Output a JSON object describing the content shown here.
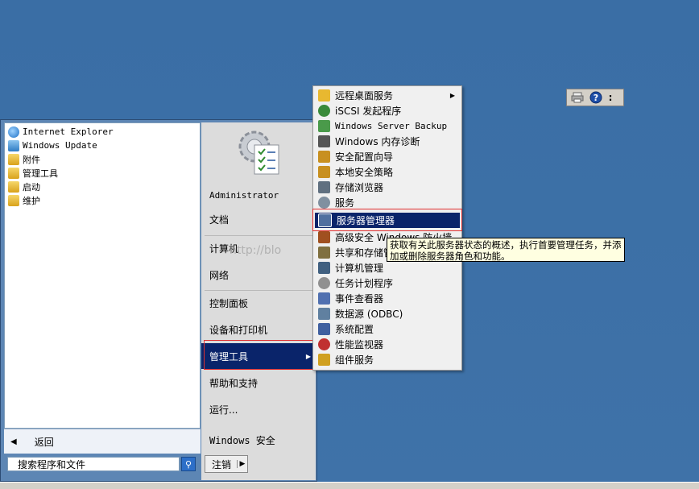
{
  "left_panel": {
    "items": [
      {
        "label": "Internet Explorer",
        "icon": "internet-explorer-icon"
      },
      {
        "label": "Windows Update",
        "icon": "windows-update-icon"
      },
      {
        "label": "附件",
        "icon": "folder-icon"
      },
      {
        "label": "管理工具",
        "icon": "folder-icon"
      },
      {
        "label": "启动",
        "icon": "folder-icon"
      },
      {
        "label": "维护",
        "icon": "folder-icon"
      }
    ],
    "back_label": "返回",
    "back_arrow": "◀",
    "search_placeholder": "搜索程序和文件",
    "search_button": "⚲"
  },
  "right_panel": {
    "user": "Administrator",
    "items": [
      "文档",
      "计算机",
      "网络",
      "控制面板",
      "设备和打印机",
      "管理工具",
      "帮助和支持",
      "运行..."
    ],
    "submenu_arrow": "▶",
    "security": "Windows 安全",
    "shutdown_label": "注销",
    "shutdown_arrow": "▶"
  },
  "submenu": {
    "items": [
      {
        "label": "远程桌面服务",
        "color": "#e8b830"
      },
      {
        "label": "iSCSI 发起程序",
        "color": "#3a8a3a"
      },
      {
        "label": "Windows Server Backup",
        "color": "#4a9a4a"
      },
      {
        "label": "Windows 内存诊断",
        "color": "#555555"
      },
      {
        "label": "安全配置向导",
        "color": "#c89020"
      },
      {
        "label": "本地安全策略",
        "color": "#c89020"
      },
      {
        "label": "存储浏览器",
        "color": "#607080"
      },
      {
        "label": "服务",
        "color": "#8090a0"
      },
      {
        "label": "服务器管理器",
        "color": "#5070a0"
      },
      {
        "label": "高级安全 Windows 防火墙",
        "color": "#a05020"
      },
      {
        "label": "共享和存储管理",
        "color": "#807040"
      },
      {
        "label": "计算机管理",
        "color": "#406080"
      },
      {
        "label": "任务计划程序",
        "color": "#909090"
      },
      {
        "label": "事件查看器",
        "color": "#5070b0"
      },
      {
        "label": "数据源 (ODBC)",
        "color": "#6080a0"
      },
      {
        "label": "系统配置",
        "color": "#4060a0"
      },
      {
        "label": "性能监视器",
        "color": "#c03030"
      },
      {
        "label": "组件服务",
        "color": "#d0a020"
      }
    ],
    "submenu_arrow": "▶"
  },
  "tooltip": {
    "line1": "获取有关此服务器状态的概述，执行首要管理任务，并添",
    "line2": "加或删除服务器角色和功能。"
  },
  "watermark": "http://blo",
  "toolbar": {
    "buttons": [
      "printer-icon",
      "help-icon",
      "more-icon"
    ],
    "help_glyph": "?",
    "more_glyph": ":"
  },
  "colors": {
    "desktop": "#3a6ea5",
    "selection": "#0a246a",
    "highlight_border": "#e03030"
  }
}
